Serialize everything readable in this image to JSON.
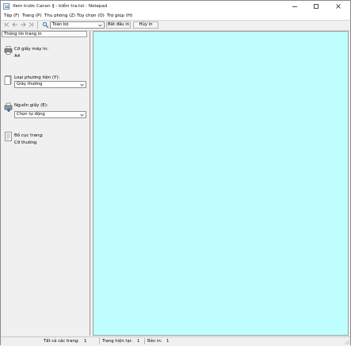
{
  "window": {
    "title": "Xem trước Canon IJ - kiểm tra.txt - Notepad"
  },
  "menu": {
    "items": [
      "Tệp (F)",
      "Trang (P)",
      "Thu phóng (Z)",
      "Tùy chọn (O)",
      "Trợ giúp (H)"
    ]
  },
  "toolbar": {
    "zoom_value": "Toàn bộ",
    "start_print_label": "Bắt đầu in",
    "cancel_print_label": "Hủy in"
  },
  "panel": {
    "header": "Thông tin trang in",
    "printer_paper_size_label": "Cỡ giấy máy in:",
    "printer_paper_size_value": "A4",
    "media_type_label": "Loại phương tiện (Y):",
    "media_type_value": "Giấy thường",
    "paper_source_label": "Nguồn giấy (E):",
    "paper_source_value": "Chọn tự động",
    "page_layout_label": "Bố cục trang:",
    "page_layout_value": "Cỡ thường"
  },
  "preview": {
    "background": "#bfffff"
  },
  "status": {
    "all_pages_label": "Tất cả các trang:",
    "all_pages_value": "1",
    "current_page_label": "Trang hiện tại:",
    "current_page_value": "1",
    "copies_label": "Bản in:",
    "copies_value": "1"
  }
}
